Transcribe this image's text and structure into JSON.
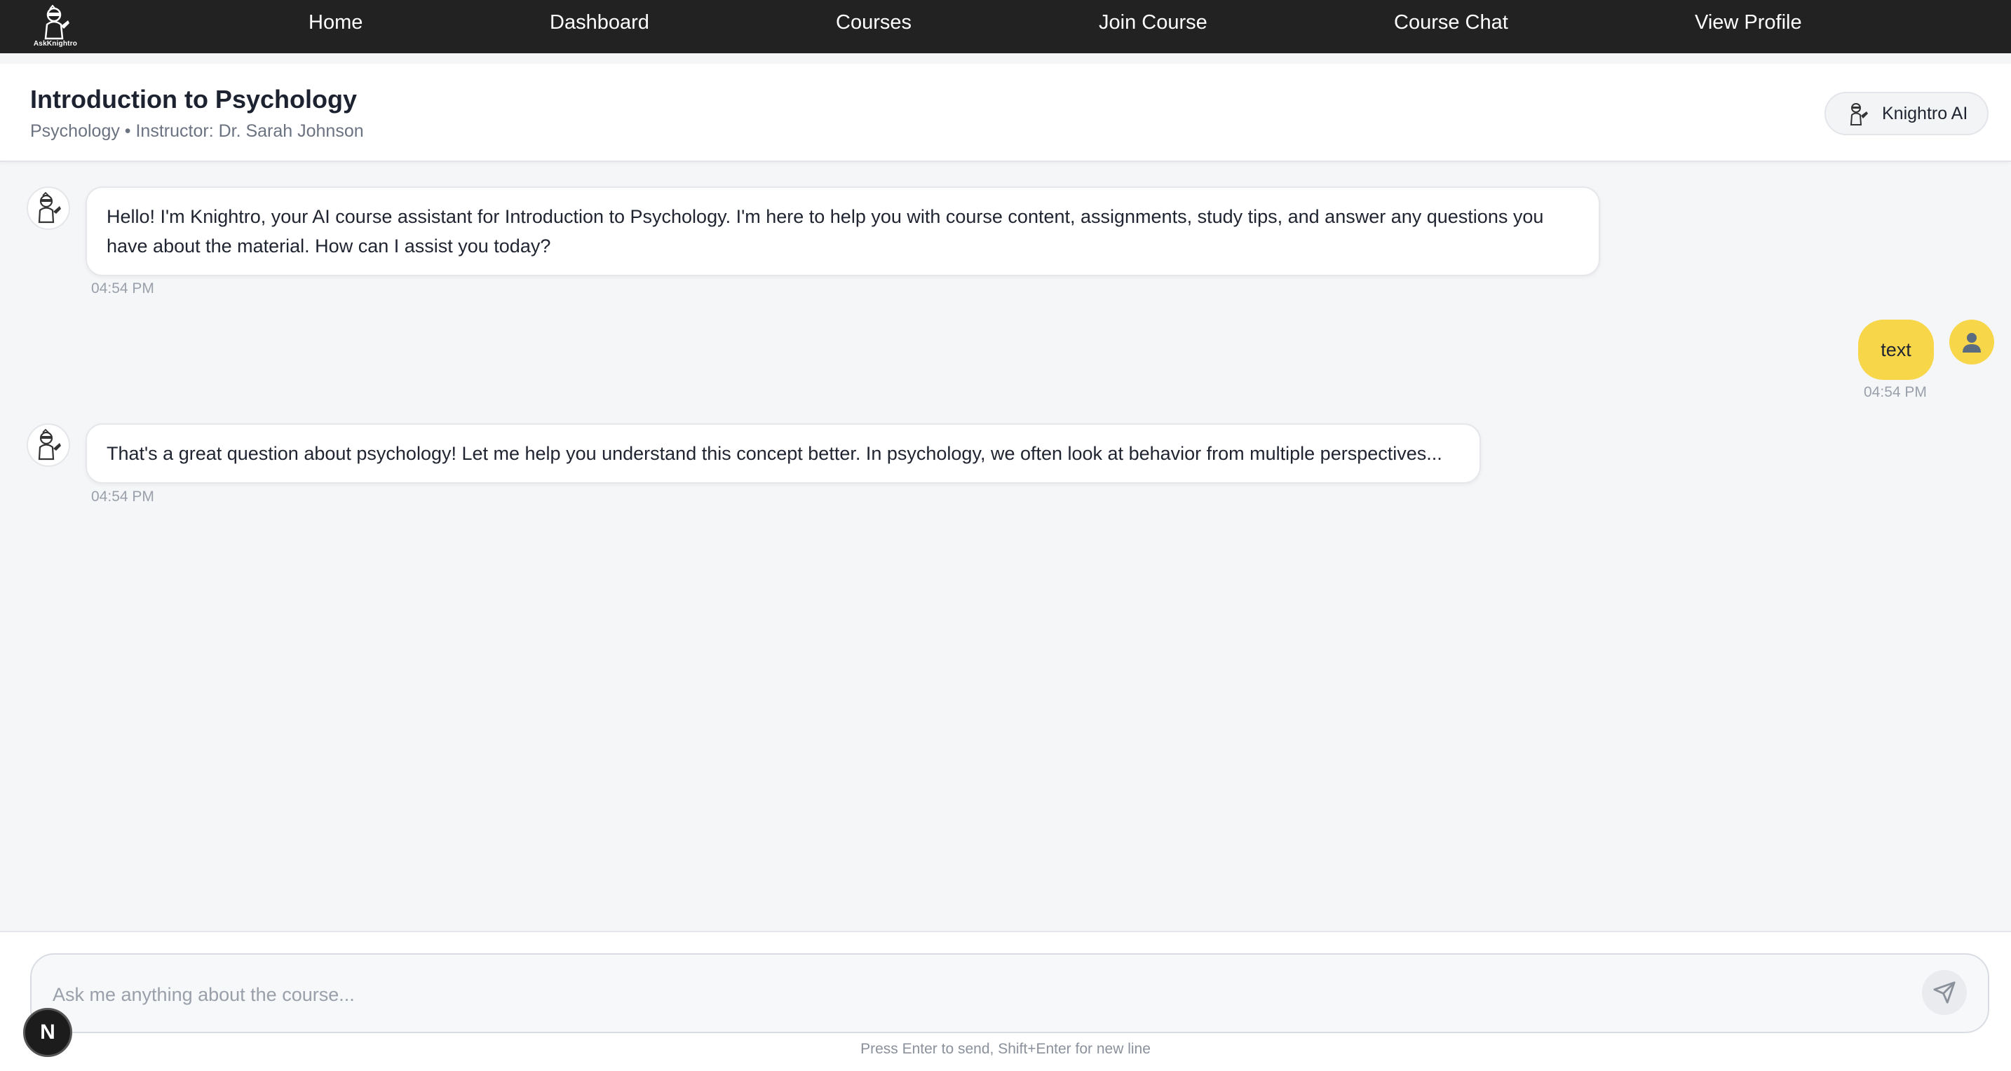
{
  "brand": {
    "logo_text": "AskKnightro",
    "logo_icon": "knight-mascot-icon"
  },
  "nav": {
    "items": [
      {
        "label": "Home"
      },
      {
        "label": "Dashboard"
      },
      {
        "label": "Courses"
      },
      {
        "label": "Join Course"
      },
      {
        "label": "Course Chat"
      },
      {
        "label": "View Profile"
      }
    ]
  },
  "course": {
    "title": "Introduction to Psychology",
    "subtitle": "Psychology • Instructor: Dr. Sarah Johnson",
    "assistant_label": "Knightro AI"
  },
  "messages": [
    {
      "sender": "bot",
      "text": "Hello! I'm Knightro, your AI course assistant for Introduction to Psychology. I'm here to help you with course content, assignments, study tips, and answer any questions you have about the material. How can I assist you today?",
      "time": "04:54 PM"
    },
    {
      "sender": "user",
      "text": "text",
      "time": "04:54 PM"
    },
    {
      "sender": "bot",
      "text": "That's a great question about psychology! Let me help you understand this concept better. In psychology, we often look at behavior from multiple perspectives...",
      "time": "04:54 PM"
    }
  ],
  "composer": {
    "placeholder": "Ask me anything about the course...",
    "value": "",
    "hint": "Press Enter to send, Shift+Enter for new line"
  },
  "dev_badge": {
    "label": "N"
  },
  "colors": {
    "nav_bg": "#222222",
    "accent_yellow": "#f7d64a",
    "page_bg": "#f5f6f8"
  }
}
